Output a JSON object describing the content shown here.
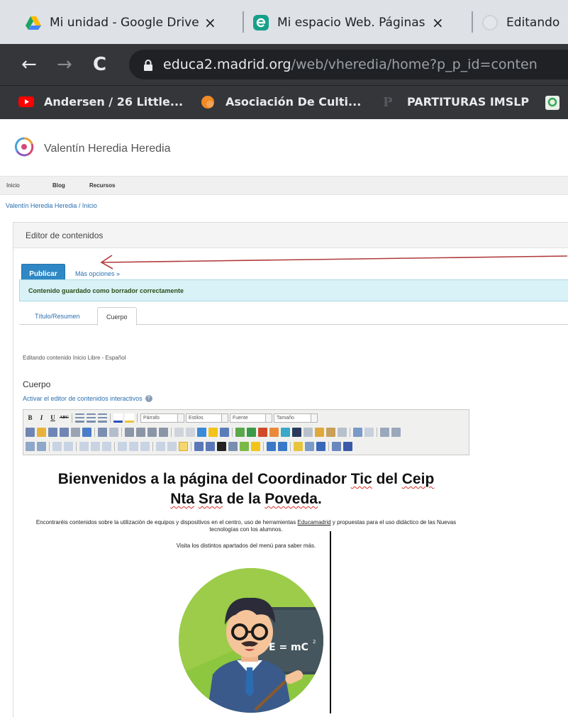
{
  "browser": {
    "tabs": [
      {
        "title": "Mi unidad - Google Drive",
        "close": "×"
      },
      {
        "title": "Mi espacio Web. Páginas",
        "close": "×"
      },
      {
        "title": "Editando"
      }
    ],
    "nav": {
      "back": "←",
      "forward": "→",
      "reload": "C"
    },
    "url": {
      "host": "educa2.madrid.org",
      "path": "/web/vheredia/home?p_p_id=conten"
    },
    "bookmarks": [
      {
        "label": "Andersen / 26 Little...",
        "icon": "youtube-icon"
      },
      {
        "label": "Asociación De Culti...",
        "icon": "orange-circle-icon"
      },
      {
        "label": "PARTITURAS IMSLP",
        "icon": "imslp-icon"
      }
    ]
  },
  "site": {
    "title": "Valentín Heredia Heredia",
    "nav": [
      "Inicio",
      "Blog",
      "Recursos"
    ],
    "breadcrumb": "Valentín Heredia Heredia / Inicio"
  },
  "editor_portlet": {
    "title": "Editor de contenidos",
    "publish_label": "Publicar",
    "more_options": "Más opciones »",
    "alert": "Contenido guardado como borrador correctamente",
    "tabs": [
      {
        "label": "Título/Resumen",
        "active": false
      },
      {
        "label": "Cuerpo",
        "active": true
      }
    ],
    "edit_info": "Editando contenido  Inicio  Libre - Español",
    "field_label": "Cuerpo",
    "interactive_link": "Activar el editor de contenidos interactivos",
    "toolbar": {
      "format_select": "Párrafo",
      "styles_select": "Estilos",
      "font_select": "Fuente",
      "size_select": "Tamaño",
      "bold": "B",
      "italic": "I",
      "underline": "U",
      "strike": "ABC"
    }
  },
  "content": {
    "heading_part1": "Bienvenidos a la página del Coordinador ",
    "heading_tic": "Tic",
    "heading_mid": " del ",
    "heading_ceip": "Ceip",
    "heading_nta": "Nta",
    "heading_sra": "Sra",
    "heading_de_la": " de la ",
    "heading_poveda": "Poveda",
    "heading_end": ".",
    "intro_a": "Encontraréis contenidos sobre la utilización de equipos y dispositivos en el centro, uso de herramientas ",
    "intro_link": "Educamadrid",
    "intro_b": " y propuestas para el uso didáctico de las Nuevas tecnologías con los alumnos.",
    "visit": "Visita los distintos apartados del menú para saber más.",
    "board_text": "E = mC",
    "board_sup": "2"
  },
  "colors": {
    "publish_button": "#2f88c5",
    "alert_bg": "#d9f2f7",
    "link": "#2a6fb0",
    "annotation_arrow": "#b03a3a"
  }
}
